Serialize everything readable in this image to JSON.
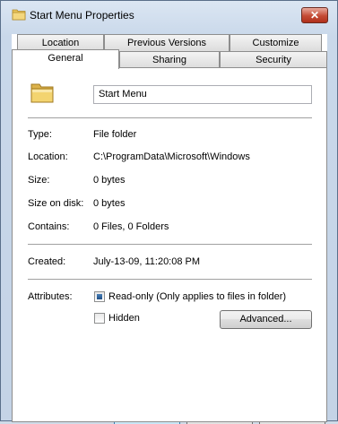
{
  "window": {
    "title": "Start Menu Properties",
    "close_glyph": "✕"
  },
  "tabs": {
    "row1": [
      "Location",
      "Previous Versions",
      "Customize"
    ],
    "row2": [
      "General",
      "Sharing",
      "Security"
    ],
    "active": "General"
  },
  "general": {
    "name_value": "Start Menu",
    "fields": [
      {
        "label": "Type:",
        "value": "File folder"
      },
      {
        "label": "Location:",
        "value": "C:\\ProgramData\\Microsoft\\Windows"
      },
      {
        "label": "Size:",
        "value": "0 bytes"
      },
      {
        "label": "Size on disk:",
        "value": "0 bytes"
      },
      {
        "label": "Contains:",
        "value": "0 Files, 0 Folders"
      }
    ],
    "created": {
      "label": "Created:",
      "value": "July-13-09, 11:20:08 PM"
    },
    "attributes": {
      "label": "Attributes:",
      "readonly": {
        "label": "Read-only (Only applies to files in folder)",
        "checked": true
      },
      "hidden": {
        "label": "Hidden",
        "checked": false
      },
      "advanced_button": "Advanced..."
    }
  },
  "icons": {
    "title": "folder-icon",
    "main": "folder-icon"
  },
  "colors": {
    "accent": "#1f4f86",
    "close": "#c44a35"
  }
}
